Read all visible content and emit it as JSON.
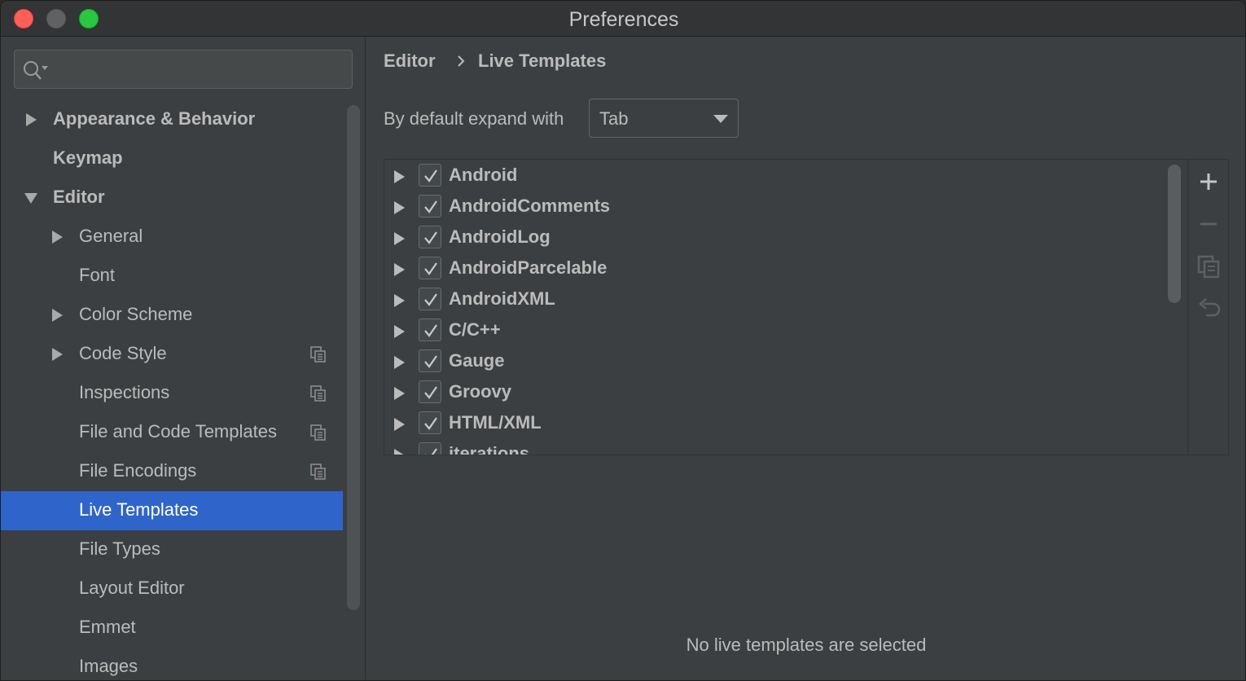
{
  "window": {
    "title": "Preferences"
  },
  "search": {
    "value": "",
    "placeholder": ""
  },
  "sidebar": {
    "items": [
      {
        "label": "Appearance & Behavior",
        "level": 0,
        "expandable": true,
        "expanded": false,
        "bold": true,
        "copy_icon": false,
        "selected": false
      },
      {
        "label": "Keymap",
        "level": 0,
        "expandable": false,
        "expanded": false,
        "bold": true,
        "copy_icon": false,
        "selected": false
      },
      {
        "label": "Editor",
        "level": 0,
        "expandable": true,
        "expanded": true,
        "bold": true,
        "copy_icon": false,
        "selected": false
      },
      {
        "label": "General",
        "level": 1,
        "expandable": true,
        "expanded": false,
        "bold": false,
        "copy_icon": false,
        "selected": false
      },
      {
        "label": "Font",
        "level": 1,
        "expandable": false,
        "expanded": false,
        "bold": false,
        "copy_icon": false,
        "selected": false
      },
      {
        "label": "Color Scheme",
        "level": 1,
        "expandable": true,
        "expanded": false,
        "bold": false,
        "copy_icon": false,
        "selected": false
      },
      {
        "label": "Code Style",
        "level": 1,
        "expandable": true,
        "expanded": false,
        "bold": false,
        "copy_icon": true,
        "selected": false
      },
      {
        "label": "Inspections",
        "level": 1,
        "expandable": false,
        "expanded": false,
        "bold": false,
        "copy_icon": true,
        "selected": false
      },
      {
        "label": "File and Code Templates",
        "level": 1,
        "expandable": false,
        "expanded": false,
        "bold": false,
        "copy_icon": true,
        "selected": false
      },
      {
        "label": "File Encodings",
        "level": 1,
        "expandable": false,
        "expanded": false,
        "bold": false,
        "copy_icon": true,
        "selected": false
      },
      {
        "label": "Live Templates",
        "level": 1,
        "expandable": false,
        "expanded": false,
        "bold": false,
        "copy_icon": false,
        "selected": true
      },
      {
        "label": "File Types",
        "level": 1,
        "expandable": false,
        "expanded": false,
        "bold": false,
        "copy_icon": false,
        "selected": false
      },
      {
        "label": "Layout Editor",
        "level": 1,
        "expandable": false,
        "expanded": false,
        "bold": false,
        "copy_icon": false,
        "selected": false
      },
      {
        "label": "Emmet",
        "level": 1,
        "expandable": false,
        "expanded": false,
        "bold": false,
        "copy_icon": false,
        "selected": false
      },
      {
        "label": "Images",
        "level": 1,
        "expandable": false,
        "expanded": false,
        "bold": false,
        "copy_icon": false,
        "selected": false
      }
    ]
  },
  "breadcrumb": {
    "parent": "Editor",
    "current": "Live Templates"
  },
  "expand_with": {
    "label": "By default expand with",
    "selected": "Tab"
  },
  "templates": {
    "groups": [
      {
        "name": "Android",
        "checked": true
      },
      {
        "name": "AndroidComments",
        "checked": true
      },
      {
        "name": "AndroidLog",
        "checked": true
      },
      {
        "name": "AndroidParcelable",
        "checked": true
      },
      {
        "name": "AndroidXML",
        "checked": true
      },
      {
        "name": "C/C++",
        "checked": true
      },
      {
        "name": "Gauge",
        "checked": true
      },
      {
        "name": "Groovy",
        "checked": true
      },
      {
        "name": "HTML/XML",
        "checked": true
      },
      {
        "name": "iterations",
        "checked": true
      }
    ],
    "toolbar": [
      "add-icon",
      "remove-icon",
      "copy-icon",
      "restore-icon"
    ]
  },
  "empty_message": "No live templates are selected",
  "colors": {
    "selection": "#2f65ca",
    "panel": "#3c3f41",
    "text": "#bbbbbb",
    "close": "#fe5f57",
    "zoom": "#28c840"
  }
}
